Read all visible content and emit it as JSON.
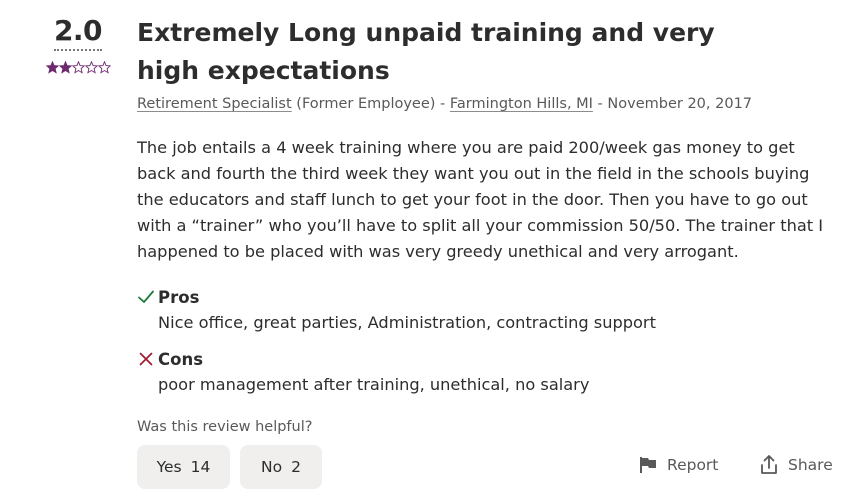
{
  "review": {
    "rating": "2.0",
    "rating_value": 2,
    "rating_max": 5,
    "star_color": "#6f2b6f",
    "title": "Extremely Long unpaid training and very high expectations",
    "meta": {
      "job_title": "Retirement Specialist",
      "employment_status": "(Former Employee)",
      "sep1": " - ",
      "location": "Farmington Hills, MI",
      "sep2": " - ",
      "date": "November 20, 2017"
    },
    "text": "The job entails a 4 week training where you are paid 200/week gas money to get back and fourth the third week they want you out in the field in the schools buying the educators and staff lunch to get your foot in the door. Then you have to go out with a “trainer” who you’ll have to split all your commission 50/50. The trainer that I happened to be placed with was very greedy unethical and very arrogant.",
    "pros": {
      "label": "Pros",
      "text": "Nice office, great parties, Administration, contracting support",
      "icon": "check-icon",
      "color": "#1f7a3a"
    },
    "cons": {
      "label": "Cons",
      "text": "poor management after training, unethical, no salary",
      "icon": "x-icon",
      "color": "#a6192e"
    }
  },
  "helpful": {
    "question": "Was this review helpful?",
    "yes_label": "Yes",
    "yes_count": "14",
    "no_label": "No",
    "no_count": "2"
  },
  "actions": {
    "report_label": "Report",
    "report_icon": "flag-icon",
    "share_label": "Share",
    "share_icon": "share-icon"
  }
}
